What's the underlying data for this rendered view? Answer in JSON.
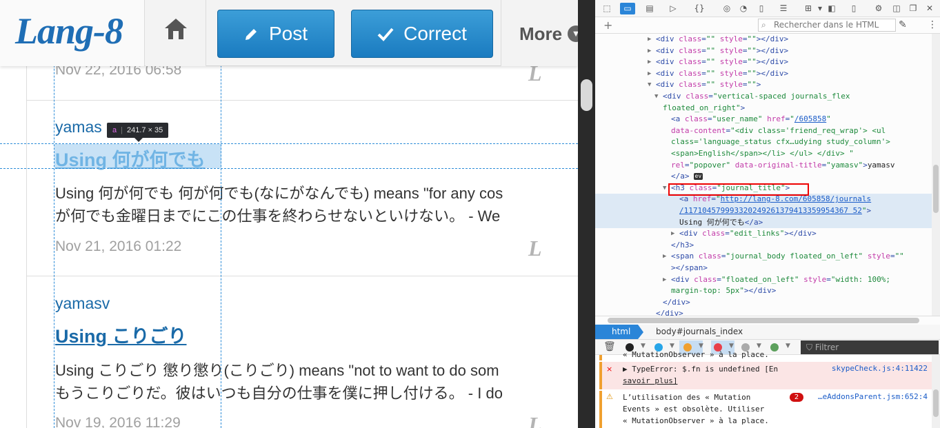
{
  "site": {
    "logo": "Lang-8",
    "nav": {
      "post_label": "Post",
      "correct_label": "Correct",
      "more_label": "More"
    }
  },
  "entries": [
    {
      "date": "Nov 22, 2016 06:58"
    },
    {
      "user": "yamas",
      "title": "Using 何が何でも",
      "body_lines": [
        "Using 何が何でも 何が何でも(なにがなんでも) means \"for any cos",
        "が何でも金曜日までにこの仕事を終わらせないといけない。 - We"
      ],
      "date": "Nov 21, 2016 01:22"
    },
    {
      "user": "yamasv",
      "title": "Using こりごり",
      "body_lines": [
        "Using こりごり 懲り懲り(こりごり) means \"not to want to do som",
        "もうこりごりだ。彼はいつも自分の仕事を僕に押し付ける。 - I do"
      ],
      "date": "Nov 19, 2016 11:29"
    }
  ],
  "badge_letter": "L",
  "inspector_tooltip": {
    "tag": "a",
    "size": "241.7 × 35"
  },
  "devtools": {
    "search_placeholder": "Rechercher dans le HTML",
    "breadcrumb": [
      "html",
      "body#journals_index"
    ],
    "filter_placeholder": "Filtrer",
    "ev_badge": "ev",
    "console": [
      {
        "type": "warning",
        "text_lines": [
          "« MutationObserver » à la place."
        ]
      },
      {
        "type": "error",
        "icon": "×",
        "text_lines": [
          "▶ TypeError: $.fn is undefined [En",
          "savoir plus]"
        ],
        "source": "skypeCheck.js:4:11422"
      },
      {
        "type": "warning",
        "icon": "⚠",
        "count": "2",
        "text_lines": [
          "L’utilisation des « Mutation",
          "Events » est obsolète. Utiliser",
          "« MutationObserver » à la place."
        ],
        "source": "…eAddonsParent.jsm:652:4"
      }
    ],
    "colors": {
      "accent": "#2a85d8",
      "error": "#e00000",
      "warning": "#f0a030"
    }
  },
  "html_tree": [
    {
      "depth": 0,
      "tw": "▶",
      "segs": [
        [
          "tg",
          "<div "
        ],
        [
          "at",
          "class"
        ],
        [
          "tg",
          "="
        ],
        [
          "vl",
          "\"\""
        ],
        [
          "tg",
          " "
        ],
        [
          "at",
          "style"
        ],
        [
          "tg",
          "="
        ],
        [
          "vl",
          "\"\""
        ],
        [
          "tg",
          "></div>"
        ]
      ]
    },
    {
      "depth": 0,
      "tw": "▶",
      "segs": [
        [
          "tg",
          "<div "
        ],
        [
          "at",
          "class"
        ],
        [
          "tg",
          "="
        ],
        [
          "vl",
          "\"\""
        ],
        [
          "tg",
          " "
        ],
        [
          "at",
          "style"
        ],
        [
          "tg",
          "="
        ],
        [
          "vl",
          "\"\""
        ],
        [
          "tg",
          "></div>"
        ]
      ]
    },
    {
      "depth": 0,
      "tw": "▶",
      "segs": [
        [
          "tg",
          "<div "
        ],
        [
          "at",
          "class"
        ],
        [
          "tg",
          "="
        ],
        [
          "vl",
          "\"\""
        ],
        [
          "tg",
          " "
        ],
        [
          "at",
          "style"
        ],
        [
          "tg",
          "="
        ],
        [
          "vl",
          "\"\""
        ],
        [
          "tg",
          "></div>"
        ]
      ]
    },
    {
      "depth": 0,
      "tw": "▶",
      "segs": [
        [
          "tg",
          "<div "
        ],
        [
          "at",
          "class"
        ],
        [
          "tg",
          "="
        ],
        [
          "vl",
          "\"\""
        ],
        [
          "tg",
          " "
        ],
        [
          "at",
          "style"
        ],
        [
          "tg",
          "="
        ],
        [
          "vl",
          "\"\""
        ],
        [
          "tg",
          "></div>"
        ]
      ]
    },
    {
      "depth": 0,
      "tw": "▼",
      "segs": [
        [
          "tg",
          "<div "
        ],
        [
          "at",
          "class"
        ],
        [
          "tg",
          "="
        ],
        [
          "vl",
          "\"\""
        ],
        [
          "tg",
          " "
        ],
        [
          "at",
          "style"
        ],
        [
          "tg",
          "="
        ],
        [
          "vl",
          "\"\""
        ],
        [
          "tg",
          ">"
        ]
      ]
    },
    {
      "depth": 1,
      "tw": "▼",
      "segs": [
        [
          "tg",
          "<div "
        ],
        [
          "at",
          "class"
        ],
        [
          "tg",
          "="
        ],
        [
          "vl",
          "\"vertical-spaced journals_flex"
        ]
      ]
    },
    {
      "depth": 1,
      "tw": "",
      "segs": [
        [
          "vl",
          "floated_on_right\""
        ],
        [
          "tg",
          ">"
        ]
      ]
    },
    {
      "depth": 2,
      "tw": "",
      "segs": [
        [
          "tg",
          "<a "
        ],
        [
          "at",
          "class"
        ],
        [
          "tg",
          "="
        ],
        [
          "vl",
          "\"user_name\""
        ],
        [
          "tg",
          " "
        ],
        [
          "at",
          "href"
        ],
        [
          "tg",
          "="
        ],
        [
          "vl",
          "\""
        ],
        [
          "lk",
          "/605858"
        ],
        [
          "vl",
          "\""
        ]
      ]
    },
    {
      "depth": 2,
      "tw": "",
      "segs": [
        [
          "at",
          "data-content"
        ],
        [
          "tg",
          "="
        ],
        [
          "vl",
          "\"<div class='friend_req_wrap'> <ul"
        ]
      ]
    },
    {
      "depth": 2,
      "tw": "",
      "segs": [
        [
          "vl",
          "class='language_status cfx…udying study_column'>"
        ]
      ]
    },
    {
      "depth": 2,
      "tw": "",
      "segs": [
        [
          "vl",
          "<span>English</span></li> </ul> </div> \""
        ]
      ]
    },
    {
      "depth": 2,
      "tw": "",
      "segs": [
        [
          "at",
          "rel"
        ],
        [
          "tg",
          "="
        ],
        [
          "vl",
          "\"popover\""
        ],
        [
          "tg",
          " "
        ],
        [
          "at",
          "data-original-title"
        ],
        [
          "tg",
          "="
        ],
        [
          "vl",
          "\"yamasv\""
        ],
        [
          "tg",
          ">"
        ],
        [
          "tx",
          "yamasv"
        ]
      ]
    },
    {
      "depth": 2,
      "tw": "",
      "segs": [
        [
          "tg",
          "</a>"
        ]
      ],
      "ev": true
    },
    {
      "depth": 2,
      "tw": "▼",
      "segs": [
        [
          "tg",
          "<h3 "
        ],
        [
          "at",
          "class"
        ],
        [
          "tg",
          "="
        ],
        [
          "vl",
          "\"journal_title\""
        ],
        [
          "tg",
          ">"
        ]
      ]
    },
    {
      "depth": 3,
      "tw": "",
      "sel": true,
      "segs": [
        [
          "tg",
          "<a "
        ],
        [
          "at",
          "href"
        ],
        [
          "tg",
          "="
        ],
        [
          "vl",
          "\""
        ],
        [
          "lk",
          "http://lang-8.com/605858/journals"
        ]
      ]
    },
    {
      "depth": 3,
      "tw": "",
      "sel": true,
      "segs": [
        [
          "lk",
          "/117104579993320249261379413359954367 52"
        ],
        [
          "vl",
          "\""
        ],
        [
          "tg",
          ">"
        ]
      ]
    },
    {
      "depth": 3,
      "tw": "",
      "sel": true,
      "segs": [
        [
          "tx",
          "Using 何が何でも"
        ],
        [
          "tg",
          "</a>"
        ]
      ]
    },
    {
      "depth": 3,
      "tw": "▶",
      "segs": [
        [
          "tg",
          "<div "
        ],
        [
          "at",
          "class"
        ],
        [
          "tg",
          "="
        ],
        [
          "vl",
          "\"edit_links\""
        ],
        [
          "tg",
          "></div>"
        ]
      ]
    },
    {
      "depth": 2,
      "tw": "",
      "segs": [
        [
          "tg",
          "</h3>"
        ]
      ]
    },
    {
      "depth": 2,
      "tw": "▶",
      "segs": [
        [
          "tg",
          "<span "
        ],
        [
          "at",
          "class"
        ],
        [
          "tg",
          "="
        ],
        [
          "vl",
          "\"journal_body floated_on_left\""
        ],
        [
          "tg",
          " "
        ],
        [
          "at",
          "style"
        ],
        [
          "tg",
          "="
        ],
        [
          "vl",
          "\"\""
        ]
      ]
    },
    {
      "depth": 2,
      "tw": "",
      "segs": [
        [
          "tg",
          "></span>"
        ]
      ]
    },
    {
      "depth": 2,
      "tw": "▶",
      "segs": [
        [
          "tg",
          "<div "
        ],
        [
          "at",
          "class"
        ],
        [
          "tg",
          "="
        ],
        [
          "vl",
          "\"floated_on_left\""
        ],
        [
          "tg",
          " "
        ],
        [
          "at",
          "style"
        ],
        [
          "tg",
          "="
        ],
        [
          "vl",
          "\"width: 100%;"
        ]
      ]
    },
    {
      "depth": 2,
      "tw": "",
      "segs": [
        [
          "vl",
          "margin-top: 5px\""
        ],
        [
          "tg",
          "></div>"
        ]
      ]
    },
    {
      "depth": 1,
      "tw": "",
      "segs": [
        [
          "tg",
          "</div>"
        ]
      ]
    },
    {
      "depth": 0,
      "tw": "",
      "segs": [
        [
          "tg",
          "</div>"
        ]
      ]
    }
  ]
}
